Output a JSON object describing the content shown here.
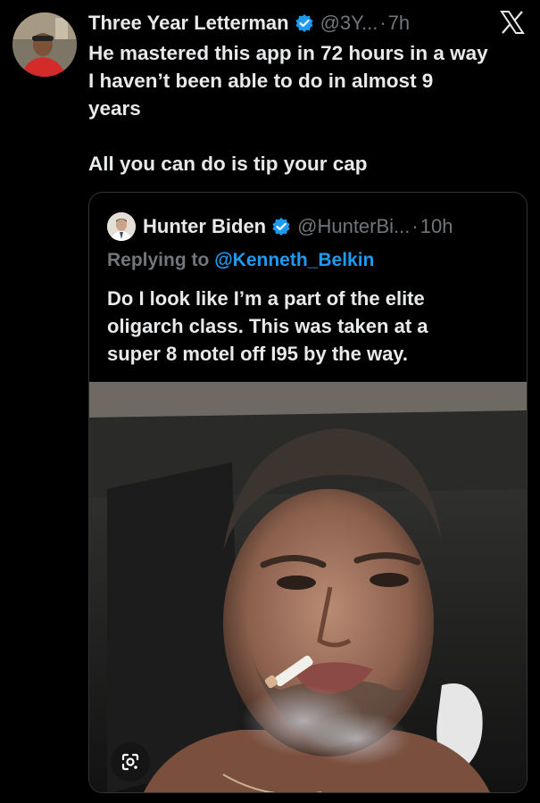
{
  "tweet": {
    "author_name": "Three Year Letterman",
    "handle": "@3Y...",
    "separator": "·",
    "time": "7h",
    "text_lines": [
      "He mastered this app in 72 hours in a way",
      "I haven’t been able to do in almost 9",
      "years"
    ],
    "text_line2": "All you can do is tip your cap",
    "avatar_icon": "profile-photo",
    "close_icon": "x-logo-icon"
  },
  "quote": {
    "author_name": "Hunter Biden",
    "handle": "@HunterBi...",
    "separator": "·",
    "time": "10h",
    "replying_prefix": "Replying to",
    "replying_mention": "@Kenneth_Belkin",
    "text_lines": [
      "Do I look like I’m a part of the elite",
      "oligarch class. This was taken at a",
      "super 8 motel off I95 by the way."
    ],
    "media_icon": "google-lens-icon"
  },
  "colors": {
    "background": "#000000",
    "text_primary": "#e7e9ea",
    "text_secondary": "#71767b",
    "link": "#1d9bf0",
    "verified": "#1d9bf0",
    "border": "#2f3336"
  }
}
